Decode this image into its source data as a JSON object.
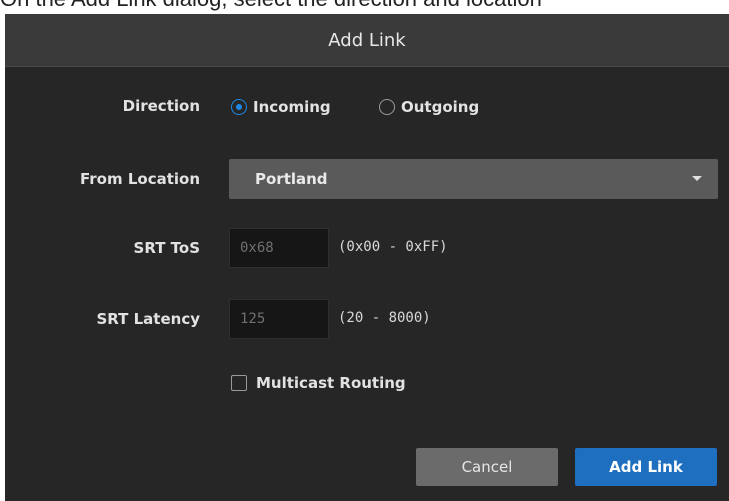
{
  "caption": "On the Add Link dialog, select the direction and location",
  "dialog": {
    "title": "Add Link",
    "direction": {
      "label": "Direction",
      "options": [
        "Incoming",
        "Outgoing"
      ],
      "selected": "Incoming"
    },
    "from_location": {
      "label": "From Location",
      "value": "Portland"
    },
    "srt_tos": {
      "label": "SRT ToS",
      "placeholder": "0x68",
      "hint": "(0x00 - 0xFF)"
    },
    "srt_latency": {
      "label": "SRT Latency",
      "placeholder": "125",
      "hint": "(20 - 8000)"
    },
    "multicast": {
      "label": "Multicast Routing",
      "checked": false
    },
    "buttons": {
      "cancel": "Cancel",
      "add": "Add Link"
    }
  },
  "colors": {
    "accent": "#1f6fc0",
    "radio_selected": "#1e88e5",
    "dialog_bg": "#262626",
    "header_bg": "#3a3a3a"
  },
  "icons": {
    "select_caret": "caret-down-icon"
  }
}
